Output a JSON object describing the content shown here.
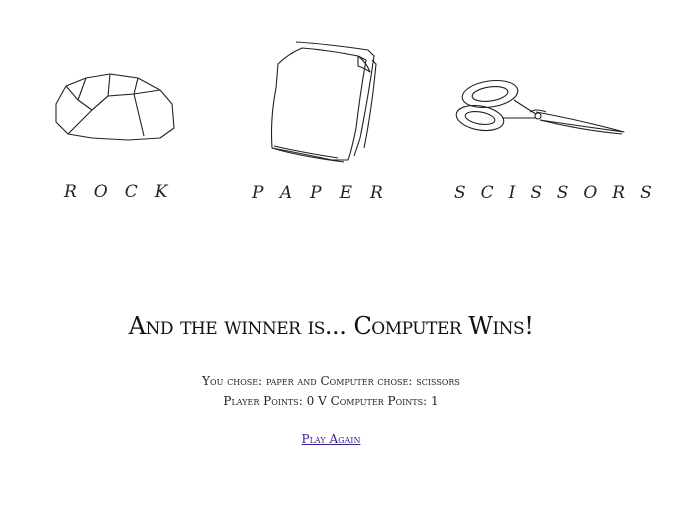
{
  "choices": [
    {
      "id": "rock",
      "label": "ROCK",
      "icon": "rock-icon"
    },
    {
      "id": "paper",
      "label": "PAPER",
      "icon": "paper-icon"
    },
    {
      "id": "scissors",
      "label": "SCISSORS",
      "icon": "scissors-icon"
    }
  ],
  "result": {
    "title": "And the winner is... Computer Wins!",
    "choices_text": "You chose: paper and Computer chose: scissors",
    "points_text": "Player Points: 0 V Computer Points: 1",
    "player_choice": "paper",
    "computer_choice": "scissors",
    "player_points": 0,
    "computer_points": 1
  },
  "actions": {
    "play_again_label": "Play Again"
  },
  "colors": {
    "background": "#ffffff",
    "text": "#111111",
    "link": "#3b1f8a"
  }
}
